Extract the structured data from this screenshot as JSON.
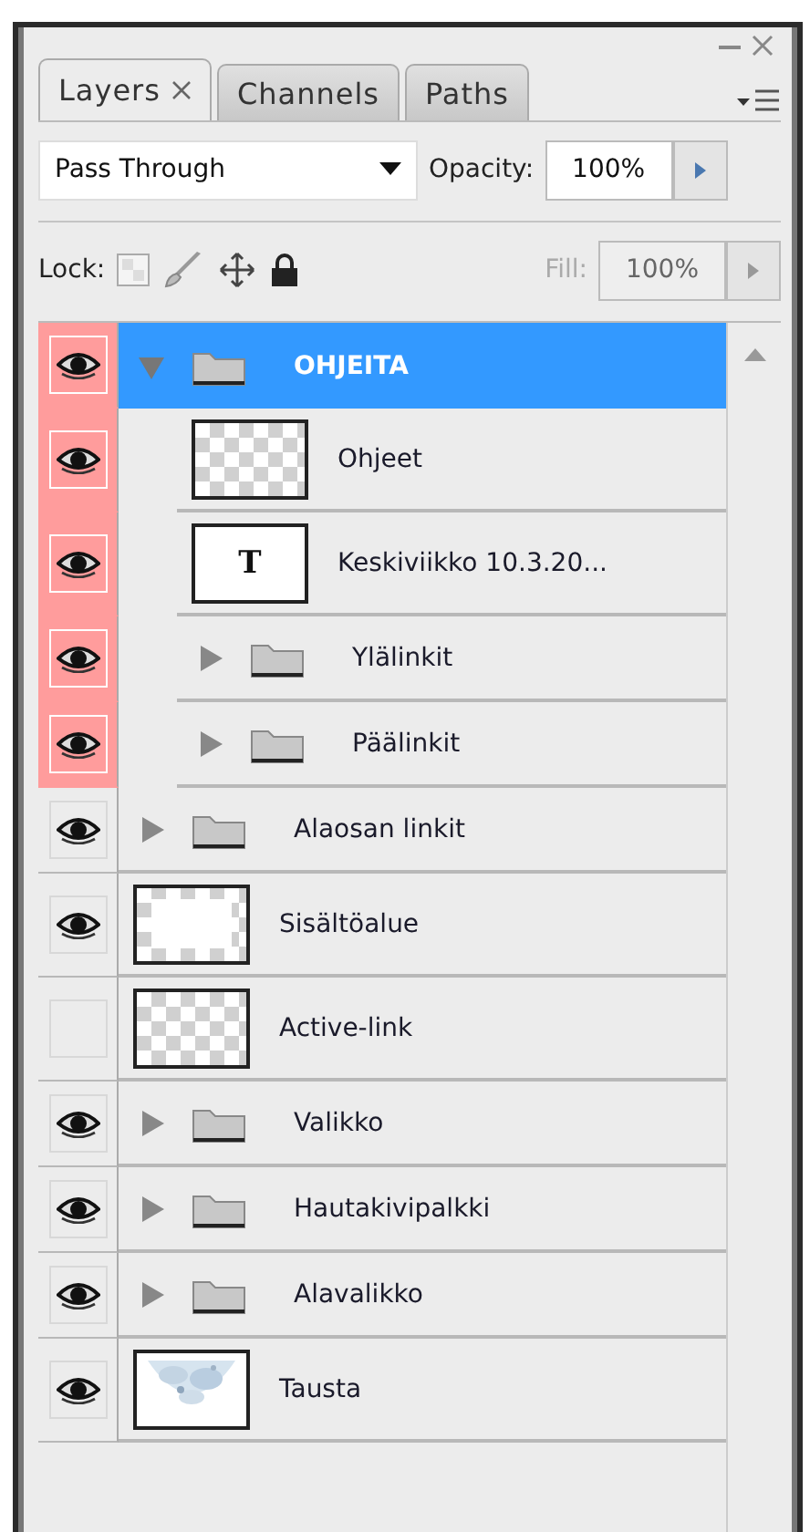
{
  "panel": {
    "tabs": [
      {
        "label": "Layers",
        "selected": true,
        "closable": true
      },
      {
        "label": "Channels",
        "selected": false,
        "closable": false
      },
      {
        "label": "Paths",
        "selected": false,
        "closable": false
      }
    ],
    "blend_mode": "Pass Through",
    "opacity_label": "Opacity:",
    "opacity": "100%",
    "lock_label": "Lock:",
    "fill_label": "Fill:",
    "fill": "100%",
    "fill_disabled": true
  },
  "layers": [
    {
      "name": "OHJEITA",
      "kind": "group",
      "visible": true,
      "selected": true,
      "expanded": true,
      "children": [
        {
          "name": "Ohjeet",
          "kind": "transparent",
          "visible": true,
          "selected": false
        },
        {
          "name": "Keskiviikko 10.3.20...",
          "kind": "text",
          "glyph": "T",
          "visible": true,
          "selected": false
        },
        {
          "name": "Ylälinkit",
          "kind": "group",
          "visible": true,
          "selected": false,
          "expanded": false
        },
        {
          "name": "Päälinkit",
          "kind": "group",
          "visible": true,
          "selected": false,
          "expanded": false
        }
      ]
    },
    {
      "name": "Alaosan linkit",
      "kind": "group",
      "visible": true,
      "selected": false,
      "expanded": false
    },
    {
      "name": "Sisältöalue",
      "kind": "framed",
      "visible": true,
      "selected": false
    },
    {
      "name": "Active-link",
      "kind": "transparent",
      "visible": false,
      "selected": false
    },
    {
      "name": "Valikko",
      "kind": "group",
      "visible": true,
      "selected": false,
      "expanded": false
    },
    {
      "name": "Hautakivipalkki",
      "kind": "group",
      "visible": true,
      "selected": false,
      "expanded": false
    },
    {
      "name": "Alavalikko",
      "kind": "group",
      "visible": true,
      "selected": false,
      "expanded": false
    },
    {
      "name": "Tausta",
      "visible": true,
      "selected": false
    }
  ]
}
